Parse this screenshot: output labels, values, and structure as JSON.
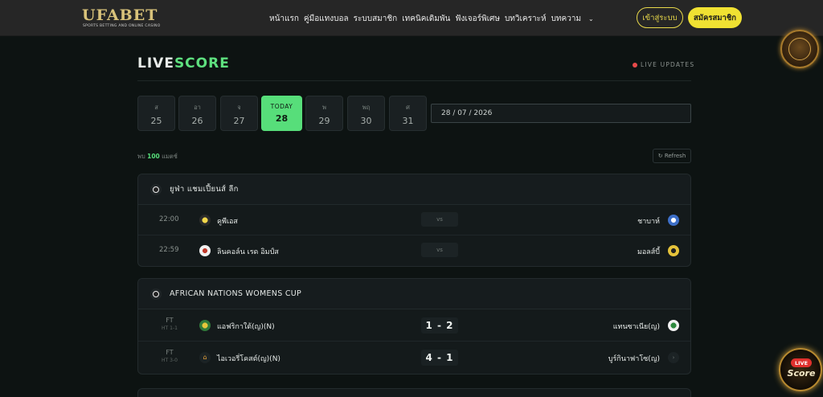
{
  "header": {
    "logo_text": "UFABET",
    "logo_sub": "SPORTS BETTING AND ONLINE CASINO",
    "nav": [
      "หน้าแรก",
      "คู่มือแทงบอล",
      "ระบบสมาชิก",
      "เทคนิคเดิมพัน",
      "ฟังเจอร์พิเศษ",
      "บทวิเคราะห์",
      "บทความ"
    ],
    "login_label": "เข้าสู่ระบบ",
    "register_label": "สมัครสมาชิก"
  },
  "page": {
    "title_white": "LIVE",
    "title_green": "SCORE",
    "live_updates": "LIVE UPDATES"
  },
  "days": [
    {
      "label": "ส",
      "num": "25"
    },
    {
      "label": "อา",
      "num": "26"
    },
    {
      "label": "จ",
      "num": "27"
    },
    {
      "label": "TODAY",
      "num": "28",
      "active": true
    },
    {
      "label": "พ",
      "num": "29"
    },
    {
      "label": "พฤ",
      "num": "30"
    },
    {
      "label": "ศ",
      "num": "31"
    }
  ],
  "date_value": "28 / 07 / 2026",
  "summary": {
    "prefix": "พบ",
    "count": "100",
    "suffix": "แมตช์"
  },
  "refresh_label": "↻ Refresh",
  "leagues": [
    {
      "name": "ยูฟ่า แชมเปี้ยนส์ ลีก",
      "matches": [
        {
          "time": "22:00",
          "home": "คูพีเอส",
          "middle": "vs",
          "away": "ชาบาห์"
        },
        {
          "time": "22:59",
          "home": "ลินคอล์น เรด อิมป์ส",
          "middle": "vs",
          "away": "มอลส์บี้"
        }
      ]
    },
    {
      "name": "AFRICAN NATIONS WOMENS CUP",
      "matches": [
        {
          "status": "FT",
          "ht": "HT 1-1",
          "home": "แอฟริกาใต้(ญ)(N)",
          "score": "1 - 2",
          "away": "แทนซาเนีย(ญ)"
        },
        {
          "status": "FT",
          "ht": "HT 3-0",
          "home": "ไอเวอรี่โคสต์(ญ)(N)",
          "score": "4 - 1",
          "away": "บูร์กินาฟาโซ(ญ)"
        }
      ]
    }
  ],
  "float_live": {
    "pill": "LIVE",
    "text": "Score"
  },
  "colors": {
    "accent_green": "#57de7a",
    "accent_yellow": "#f0e132",
    "live_red": "#e84a4a"
  }
}
